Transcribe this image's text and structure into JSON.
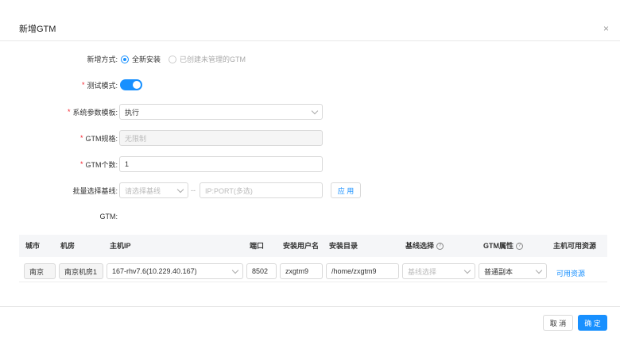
{
  "dialog": {
    "title": "新增GTM",
    "close_glyph": "×"
  },
  "form": {
    "mode": {
      "label": "新增方式:",
      "options": [
        "全新安装",
        "已创建未管理的GTM"
      ],
      "selected": "全新安装"
    },
    "test_mode": {
      "label": "测试模式:",
      "enabled": true
    },
    "sys_template": {
      "label": "系统参数模板:",
      "value": "执行"
    },
    "gtm_spec": {
      "label": "GTM规格:",
      "value": "无限制"
    },
    "gtm_count": {
      "label": "GTM个数:",
      "value": "1"
    },
    "baseline": {
      "label": "批量选择基线:",
      "placeholder": "请选择基线",
      "separator": "--",
      "ipport_placeholder": "IP:PORT(多选)",
      "apply_label": "应 用"
    },
    "gtm_section_label": "GTM:"
  },
  "table": {
    "columns": [
      "城市",
      "机房",
      "主机IP",
      "端口",
      "安装用户名",
      "安装目录",
      "基线选择",
      "GTM属性",
      "主机可用资源"
    ],
    "help_glyph": "?",
    "rows": [
      {
        "city": "南京",
        "room": "南京机房1",
        "host_ip": "167-rhv7.6(10.229.40.167)",
        "port": "8502",
        "user": "zxgtm9",
        "dir": "/home/zxgtm9",
        "baseline_placeholder": "基线选择",
        "gtm_attr": "普通副本",
        "resource_link": "可用资源"
      }
    ]
  },
  "footer": {
    "cancel_label": "取 消",
    "ok_label": "确 定"
  },
  "colors": {
    "accent": "#1890ff",
    "required": "#f5222d"
  }
}
